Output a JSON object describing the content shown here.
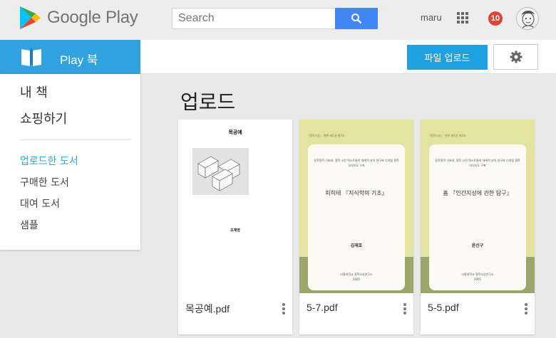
{
  "header": {
    "logo_text": "Google Play",
    "search_placeholder": "Search",
    "username": "maru",
    "notification_count": "10"
  },
  "app": {
    "name": "Play 북"
  },
  "toolbar": {
    "upload_label": "파일 업로드"
  },
  "sidebar": {
    "main_items": [
      {
        "label": "내 책"
      },
      {
        "label": "쇼핑하기"
      }
    ],
    "sub_items": [
      {
        "label": "업로드한 도서",
        "active": true
      },
      {
        "label": "구매한 도서"
      },
      {
        "label": "대여 도서"
      },
      {
        "label": "샘플"
      }
    ]
  },
  "main": {
    "title": "업로드",
    "books": [
      {
        "file_name": "목공예.pdf",
        "cover_title": "목공예",
        "cover_author": "조재영"
      },
      {
        "file_name": "5-7.pdf",
        "cover_series": "『철학사상』 별책 제5권 제7호",
        "cover_desc": "동학철학 기초와, 철학 고전 텍스트들의 체계적 분석 연구와 디지털 철학 지식지도 구축",
        "cover_title": "피히테 『지식학의 기초』",
        "cover_author": "김재호",
        "cover_publisher": "서울대학교 철학사상연구소",
        "cover_year": "2005"
      },
      {
        "file_name": "5-5.pdf",
        "cover_series": "『철학사상』 별책 제5권 제5호",
        "cover_desc": "동학철학 기초와, 철학 고전 텍스트들의 체계적 분석 연구와 디지털 철학 지식지도 구축",
        "cover_title": "흄 『인간지성에 관한 탐구』",
        "cover_author": "윤선구",
        "cover_publisher": "서울대학교 철학사상연구소",
        "cover_year": "2005"
      }
    ]
  },
  "colors": {
    "brand_blue": "#31a2e0",
    "upload_button": "#1fa1e1",
    "search_button": "#4285f4",
    "notification": "#db4437"
  }
}
